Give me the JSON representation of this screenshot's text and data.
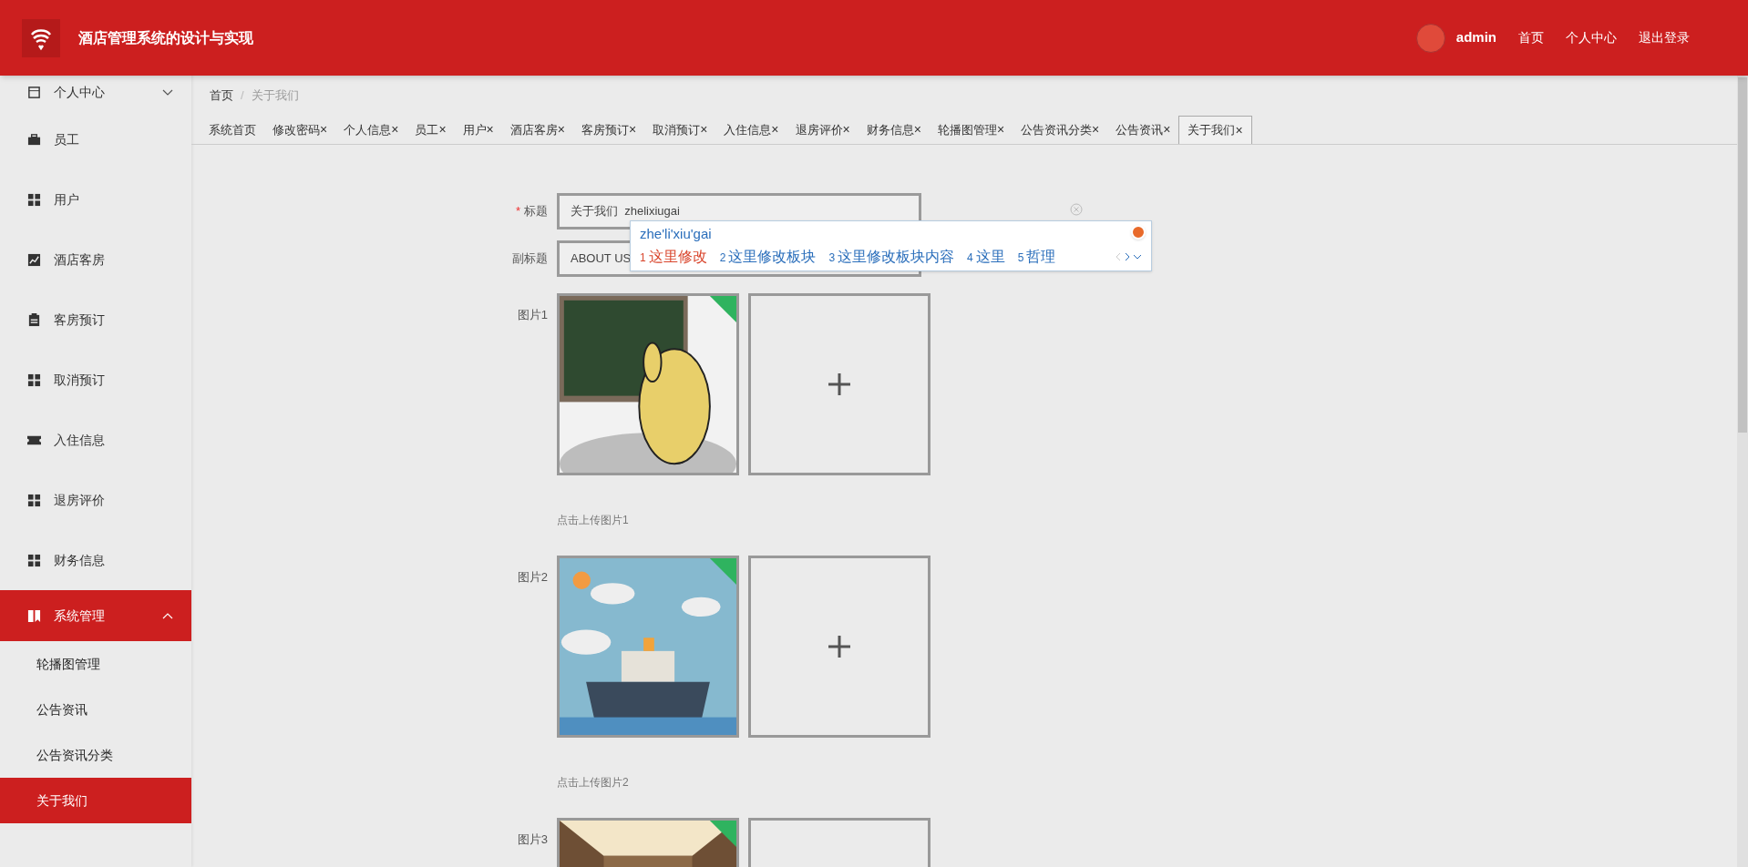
{
  "header": {
    "title": "酒店管理系统的设计与实现",
    "user": "admin",
    "links": [
      "首页",
      "个人中心",
      "退出登录"
    ]
  },
  "sidebar": {
    "items": [
      {
        "label": "个人中心",
        "kind": "calendar",
        "selected": false,
        "expanded": false
      },
      {
        "label": "员工",
        "kind": "briefcase",
        "selected": false
      },
      {
        "label": "用户",
        "kind": "grid",
        "selected": false
      },
      {
        "label": "酒店客房",
        "kind": "chart",
        "selected": false
      },
      {
        "label": "客房预订",
        "kind": "clipboard",
        "selected": false
      },
      {
        "label": "取消预订",
        "kind": "grid",
        "selected": false
      },
      {
        "label": "入住信息",
        "kind": "ticket",
        "selected": false
      },
      {
        "label": "退房评价",
        "kind": "grid",
        "selected": false
      },
      {
        "label": "财务信息",
        "kind": "grid",
        "selected": false
      },
      {
        "label": "系统管理",
        "kind": "book",
        "selected": true,
        "expanded": true,
        "children": [
          {
            "label": "轮播图管理",
            "selected": false
          },
          {
            "label": "公告资讯",
            "selected": false
          },
          {
            "label": "公告资讯分类",
            "selected": false
          },
          {
            "label": "关于我们",
            "selected": true
          }
        ]
      }
    ]
  },
  "breadcrumb": {
    "items": [
      "首页",
      "关于我们"
    ],
    "separator": "/"
  },
  "tabs": [
    {
      "label": "系统首页",
      "selected": false
    },
    {
      "label": "修改密码",
      "close": "×",
      "selected": false
    },
    {
      "label": "个人信息",
      "close": "×",
      "selected": false
    },
    {
      "label": "员工",
      "close": "×",
      "selected": false
    },
    {
      "label": "用户",
      "close": "×",
      "selected": false
    },
    {
      "label": "酒店客房",
      "close": "×",
      "selected": false
    },
    {
      "label": "客房预订",
      "close": "×",
      "selected": false
    },
    {
      "label": "取消预订",
      "close": "×",
      "selected": false
    },
    {
      "label": "入住信息",
      "close": "×",
      "selected": false
    },
    {
      "label": "退房评价",
      "close": "×",
      "selected": false
    },
    {
      "label": "财务信息",
      "close": "×",
      "selected": false
    },
    {
      "label": "轮播图管理",
      "close": "×",
      "selected": false
    },
    {
      "label": "公告资讯分类",
      "close": "×",
      "selected": false
    },
    {
      "label": "公告资讯",
      "close": "×",
      "selected": false
    },
    {
      "label": "关于我们",
      "close": "×",
      "selected": true
    }
  ],
  "form": {
    "fields": [
      {
        "label": "标题",
        "required_mark": "*",
        "value": "关于我们  zhelixiugai"
      },
      {
        "label": "副标题",
        "value": "ABOUT US"
      }
    ],
    "ime": {
      "composition": "zhe'li'xiu'gai",
      "candidates": [
        {
          "index": "1",
          "text": "这里修改",
          "selected": true
        },
        {
          "index": "2",
          "text": "这里修改板块",
          "selected": false
        },
        {
          "index": "3",
          "text": "这里修改板块内容",
          "selected": false
        },
        {
          "index": "4",
          "text": "这里",
          "selected": false
        },
        {
          "index": "5",
          "text": "哲理",
          "selected": false
        }
      ]
    },
    "images": [
      {
        "label": "图片1",
        "caption": "点击上传图片1"
      },
      {
        "label": "图片2",
        "caption": "点击上传图片2"
      },
      {
        "label": "图片3"
      }
    ]
  }
}
